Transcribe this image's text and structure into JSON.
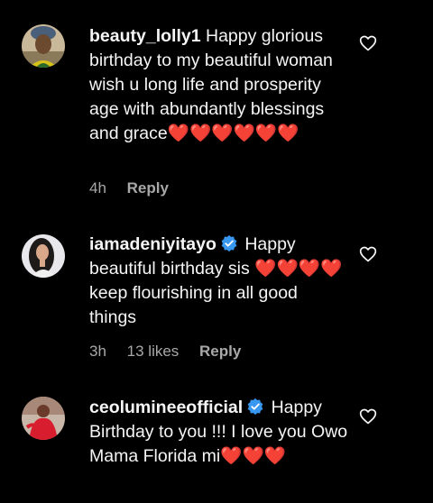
{
  "comments": [
    {
      "username": "beauty_lolly1",
      "verified": false,
      "text": "Happy glorious birthday to my beautiful woman wish u long life and prosperity age with abundantly blessings and grace❤️❤️❤️❤️❤️❤️",
      "time": "4h",
      "likes": "",
      "reply_label": "Reply"
    },
    {
      "username": "iamadeniyitayo",
      "verified": true,
      "text": "Happy beautiful birthday sis ❤️❤️❤️❤️ keep flourishing in all good things",
      "time": "3h",
      "likes": "13 likes",
      "reply_label": "Reply"
    },
    {
      "username": "ceolumineeofficial",
      "verified": true,
      "text": "Happy Birthday to you !!! I love you Owo Mama Florida mi❤️❤️❤️",
      "time": "",
      "likes": "",
      "reply_label": ""
    }
  ],
  "colors": {
    "background": "#000000",
    "text": "#f5f5f5",
    "meta": "#a8a8a8",
    "verified": "#3897f0",
    "heart": "#e0245e"
  },
  "icons": {
    "like": "heart-outline-icon",
    "verified": "verified-badge-icon"
  }
}
